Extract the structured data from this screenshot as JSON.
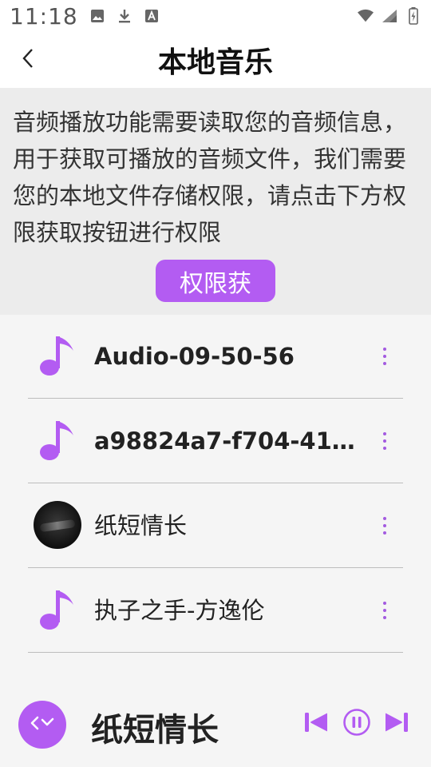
{
  "status_bar": {
    "time": "11:18",
    "icons": [
      "image-icon",
      "download-icon",
      "a-box-icon",
      "wifi-icon",
      "signal-icon",
      "battery-charging-icon"
    ]
  },
  "app_bar": {
    "back_icon": "chevron-left-icon",
    "title": "本地音乐"
  },
  "permission": {
    "message": "音频播放功能需要读取您的音频信息，用于获取可播放的音频文件，我们需要您的本地文件存储权限，请点击下方权限获取按钮进行权限",
    "button_label": "权限获"
  },
  "songs": [
    {
      "title": "Audio-09-50-56",
      "icon": "music-note-icon"
    },
    {
      "title": "a98824a7-f704-41e5-..",
      "icon": "music-note-icon"
    },
    {
      "title": "纸短情长",
      "icon": "album-cover"
    },
    {
      "title": "执子之手-方逸伦",
      "icon": "music-note-icon"
    }
  ],
  "player": {
    "now_playing": "纸短情长",
    "controls": [
      "skip-previous-icon",
      "pause-icon",
      "skip-next-icon"
    ]
  },
  "colors": {
    "accent": "#b35cf2",
    "panel_bg": "#ececec",
    "page_bg": "#f5f5f5"
  }
}
